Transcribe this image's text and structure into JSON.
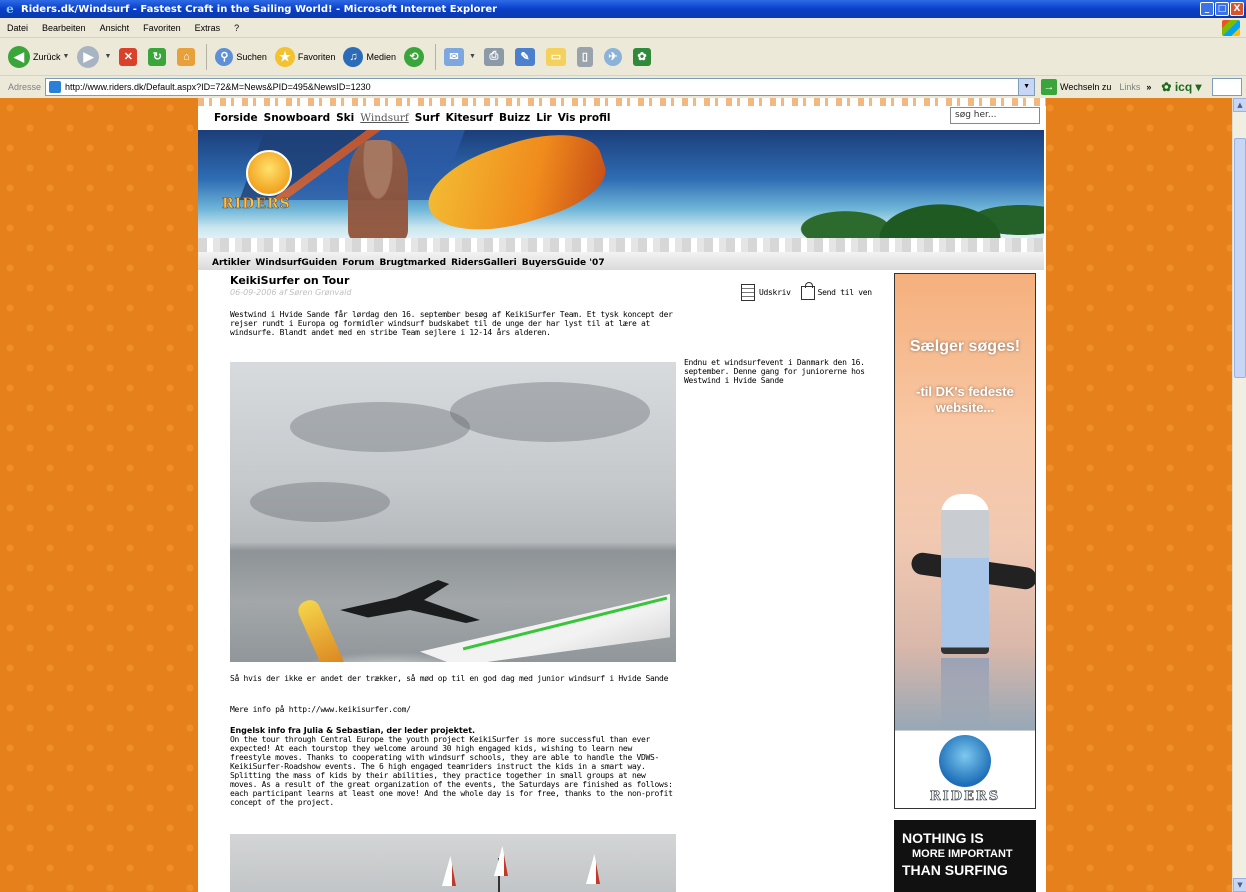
{
  "window": {
    "title": "Riders.dk/Windsurf - Fastest Craft in the Sailing World! - Microsoft Internet Explorer",
    "controls": [
      "_",
      "□",
      "X"
    ]
  },
  "menu": [
    "Datei",
    "Bearbeiten",
    "Ansicht",
    "Favoriten",
    "Extras",
    "?"
  ],
  "toolbar": {
    "back": "Zurück",
    "search": "Suchen",
    "favorites": "Favoriten",
    "media": "Medien"
  },
  "addressbar": {
    "label": "Adresse",
    "url": "http://www.riders.dk/Default.aspx?ID=72&M=News&PID=495&NewsID=1230",
    "go": "Wechseln zu",
    "links": "Links",
    "chevron": "»",
    "icq": "icq"
  },
  "site": {
    "nav": [
      "Forside",
      "Snowboard",
      "Ski",
      "Windsurf",
      "Surf",
      "Kitesurf",
      "Buizz",
      "Lir",
      "Vis profil"
    ],
    "active_nav": "Windsurf",
    "search_placeholder": "søg her...",
    "banner_logo": "RIDERS",
    "subnav": [
      "Artikler",
      "WindsurfGuiden",
      "Forum",
      "Brugtmarked",
      "RidersGalleri",
      "BuyersGuide '07"
    ]
  },
  "article": {
    "title": "KeikiSurfer on Tour",
    "byline": "06-09-2006 af Søren Grønvald",
    "print": "Udskriv",
    "send": "Send til ven",
    "intro": "Westwind i Hvide Sande får lørdag den 16. september besøg af KeikiSurfer Team. Et tysk koncept der rejser rundt i Europa og formidler windsurf budskabet til de unge der har lyst til at lære at windsurfe. Blandt andet med en stribe Team sejlere i 12-14 års alderen.",
    "side_caption": "Endnu et windsurfevent i Danmark den 16. september. Denne gang for juniorerne hos Westwind i Hvide Sande",
    "p1": "Så hvis der ikke er andet der trækker, så mød op til en god dag med junior windsurf i Hvide Sande",
    "p2": "Mere info på http://www.keikisurfer.com/",
    "p3_heading": "Engelsk info fra Julia & Sebastian, der leder projektet.",
    "p3": "On the tour through Central Europe the youth project KeikiSurfer is more successful than ever expected! At each tourstop they welcome around 30 high engaged kids, wishing to learn new freestyle moves. Thanks to cooperating with windsurf schools, they are able to handle the VDWS-KeikiSurfer-Roadshow events. The 6 high engaged teamriders instruct the kids in a smart way. Splitting the mass of kids by their abilities, they practice together in small groups at new moves. As a result of the great organization of the events, the Saturdays are finished as follows: each participant learns at least one move! And the whole day is for free, thanks to the non-profit concept of the project."
  },
  "ads": {
    "ad1_headline": "Sælger søges!",
    "ad1_sub": "-til DK's fedeste website...",
    "ad1_logo": "RIDERS",
    "ad2_l1": "NOTHING IS",
    "ad2_l2": "MORE IMPORTANT",
    "ad2_l3": "THAN SURFING"
  }
}
